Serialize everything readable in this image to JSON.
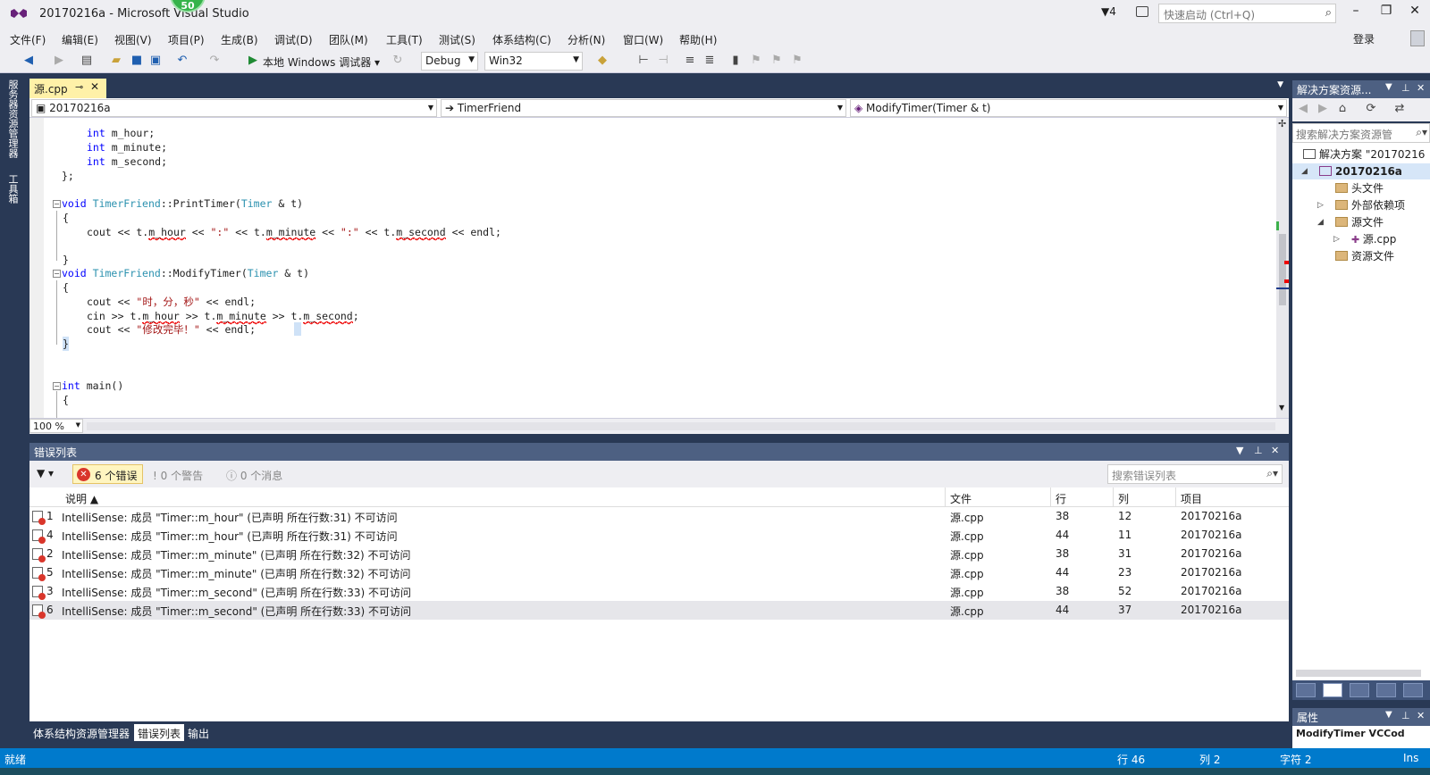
{
  "window": {
    "title": "20170216a - Microsoft Visual Studio",
    "badge": "50",
    "notifications": "4",
    "quick_launch_placeholder": "快速启动 (Ctrl+Q)",
    "login": "登录"
  },
  "menu": [
    "文件(F)",
    "编辑(E)",
    "视图(V)",
    "项目(P)",
    "生成(B)",
    "调试(D)",
    "团队(M)",
    "工具(T)",
    "测试(S)",
    "体系结构(C)",
    "分析(N)",
    "窗口(W)",
    "帮助(H)"
  ],
  "toolbar": {
    "debugger": "本地 Windows 调试器",
    "config": "Debug",
    "platform": "Win32"
  },
  "left_rail": [
    "服务器资源管理器",
    "工具箱"
  ],
  "editor": {
    "tab": "源.cpp",
    "nav_project": "20170216a",
    "nav_class": "TimerFriend",
    "nav_member": "ModifyTimer(Timer & t)",
    "zoom": "100 %",
    "lines": {
      "l1_kw": "int",
      "l1_rest": " m_hour;",
      "l2_kw": "int",
      "l2_rest": " m_minute;",
      "l3_kw": "int",
      "l3_rest": " m_second;",
      "l4": "};",
      "l5_kw": "void",
      "l5_ty": "TimerFriend",
      "l5_mid": "::PrintTimer(",
      "l5_ty2": "Timer",
      "l5_end": " & t)",
      "l6": "{",
      "l7_a": "cout << t.",
      "l7_b": "m_hour",
      "l7_c": " << ",
      "l7_s": "\":\"",
      "l7_d": " << t.",
      "l7_e": "m_minute",
      "l7_f": " << ",
      "l7_s2": "\":\"",
      "l7_g": " << t.",
      "l7_h": "m_second",
      "l7_i": " << endl;",
      "l8": "}",
      "l9_kw": "void",
      "l9_ty": "TimerFriend",
      "l9_mid": "::ModifyTimer(",
      "l9_ty2": "Timer",
      "l9_end": " & t)",
      "l10": "{",
      "l11_a": "cout << ",
      "l11_s": "\"时，分，秒\"",
      "l11_b": " << endl;",
      "l12_a": "cin >> t.",
      "l12_b": "m_hour",
      "l12_c": " >> t.",
      "l12_d": "m_minute",
      "l12_e": " >> t.",
      "l12_f": "m_second",
      "l12_g": ";",
      "l13_a": "cout << ",
      "l13_s": "\"修改完毕！\"",
      "l13_b": " << endl;",
      "l14": "}",
      "l15_kw": "int",
      "l15_rest": " main()",
      "l16": "{"
    }
  },
  "error_list": {
    "title": "错误列表",
    "errors_label": "6 个错误",
    "warnings_label": "0 个警告",
    "messages_label": "0 个消息",
    "search_placeholder": "搜索错误列表",
    "headers": {
      "desc": "说明",
      "file": "文件",
      "line": "行",
      "col": "列",
      "project": "项目"
    },
    "rows": [
      {
        "num": "1",
        "desc": "IntelliSense:  成员 \"Timer::m_hour\" (已声明 所在行数:31) 不可访问",
        "file": "源.cpp",
        "line": "38",
        "col": "12",
        "project": "20170216a"
      },
      {
        "num": "4",
        "desc": "IntelliSense:  成员 \"Timer::m_hour\" (已声明 所在行数:31) 不可访问",
        "file": "源.cpp",
        "line": "44",
        "col": "11",
        "project": "20170216a"
      },
      {
        "num": "2",
        "desc": "IntelliSense:  成员 \"Timer::m_minute\" (已声明 所在行数:32) 不可访问",
        "file": "源.cpp",
        "line": "38",
        "col": "31",
        "project": "20170216a"
      },
      {
        "num": "5",
        "desc": "IntelliSense:  成员 \"Timer::m_minute\" (已声明 所在行数:32) 不可访问",
        "file": "源.cpp",
        "line": "44",
        "col": "23",
        "project": "20170216a"
      },
      {
        "num": "3",
        "desc": "IntelliSense:  成员 \"Timer::m_second\" (已声明 所在行数:33) 不可访问",
        "file": "源.cpp",
        "line": "38",
        "col": "52",
        "project": "20170216a"
      },
      {
        "num": "6",
        "desc": "IntelliSense:  成员 \"Timer::m_second\" (已声明 所在行数:33) 不可访问",
        "file": "源.cpp",
        "line": "44",
        "col": "37",
        "project": "20170216a"
      }
    ]
  },
  "bottom_tabs": [
    "体系结构资源管理器",
    "错误列表",
    "输出"
  ],
  "solution_explorer": {
    "title": "解决方案资源...",
    "search_placeholder": "搜索解决方案资源管",
    "solution": "解决方案 \"20170216",
    "project": "20170216a",
    "headers": "头文件",
    "external": "外部依赖项",
    "sources": "源文件",
    "source_file": "源.cpp",
    "resources": "资源文件"
  },
  "properties": {
    "title": "属性",
    "value": "ModifyTimer VCCod"
  },
  "status": {
    "ready": "就绪",
    "line": "行 46",
    "col": "列 2",
    "char": "字符 2",
    "mode": "Ins"
  },
  "colors": {
    "accent": "#007acc",
    "tool_header": "#4d6082",
    "error_red": "#d9362b"
  }
}
